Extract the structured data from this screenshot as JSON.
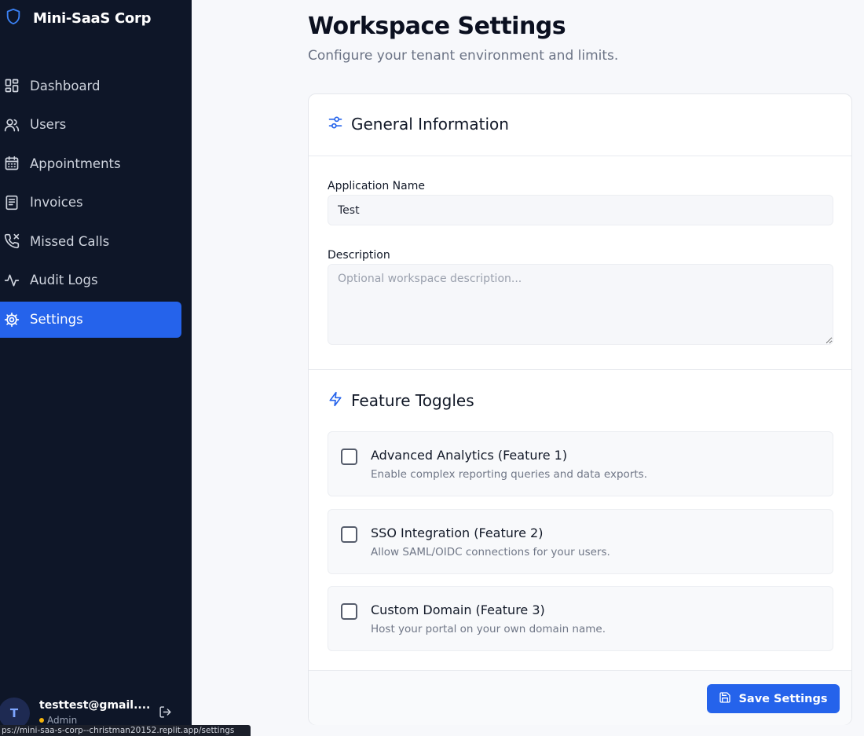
{
  "brand": {
    "name": "Mini-SaaS Corp",
    "icon": "shield-icon"
  },
  "sidebar": {
    "items": [
      {
        "label": "Dashboard",
        "icon": "grid-icon"
      },
      {
        "label": "Users",
        "icon": "users-icon"
      },
      {
        "label": "Appointments",
        "icon": "calendar-icon"
      },
      {
        "label": "Invoices",
        "icon": "document-icon"
      },
      {
        "label": "Missed Calls",
        "icon": "phone-missed-icon"
      },
      {
        "label": "Audit Logs",
        "icon": "activity-icon"
      },
      {
        "label": "Settings",
        "icon": "gear-icon",
        "active": true
      }
    ],
    "user": {
      "avatar": "T",
      "email": "testtest@gmail....",
      "role": "Admin"
    }
  },
  "status_bar": {
    "url": "ps://mini-saa-s-corp--christman20152.replit.app/settings"
  },
  "page": {
    "title": "Workspace Settings",
    "subtitle": "Configure your tenant environment and limits."
  },
  "general": {
    "heading": "General Information",
    "app_name_label": "Application Name",
    "app_name_value": "Test",
    "description_label": "Description",
    "description_placeholder": "Optional workspace description..."
  },
  "features": {
    "heading": "Feature Toggles",
    "items": [
      {
        "title": "Advanced Analytics (Feature 1)",
        "desc": "Enable complex reporting queries and data exports.",
        "checked": false
      },
      {
        "title": "SSO Integration (Feature 2)",
        "desc": "Allow SAML/OIDC connections for your users.",
        "checked": false
      },
      {
        "title": "Custom Domain (Feature 3)",
        "desc": "Host your portal on your own domain name.",
        "checked": false
      }
    ]
  },
  "actions": {
    "save_label": "Save Settings"
  },
  "colors": {
    "accent": "#2563eb",
    "sidebar_bg": "#0e1628",
    "status_dot": "#f5b40b"
  }
}
